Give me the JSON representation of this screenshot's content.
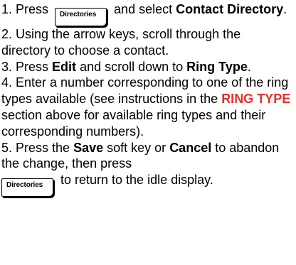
{
  "steps": [
    {
      "number": "1. ",
      "press": "Press",
      "key_label": "Directories",
      "and_select": "and select",
      "target": "Contact Directory",
      "end": "."
    },
    {
      "number": "2. ",
      "text": "Using the arrow keys, scroll through the directory to choose a contact."
    },
    {
      "number": "3. ",
      "press": "Press",
      "edit": "Edit",
      "scroll": "and scroll down to",
      "target": "Ring Type",
      "end": "."
    },
    {
      "number": "4. ",
      "text_a": "Enter a number corresponding to one of the ring types available (see instructions in the",
      "section_ref": "RING TYPE",
      "text_b": "section above for available ring types and their corresponding numbers)."
    },
    {
      "number": "5. ",
      "press": "Press the",
      "save": "Save",
      "soft_or": "soft key or",
      "cancel": "Cancel",
      "abandon": "to abandon the change, then press",
      "key_label": "Directories",
      "return": "to return to the idle display."
    }
  ],
  "colors": {
    "text": "#000000",
    "section_ref": "#e8312a",
    "background": "#ffffff"
  }
}
